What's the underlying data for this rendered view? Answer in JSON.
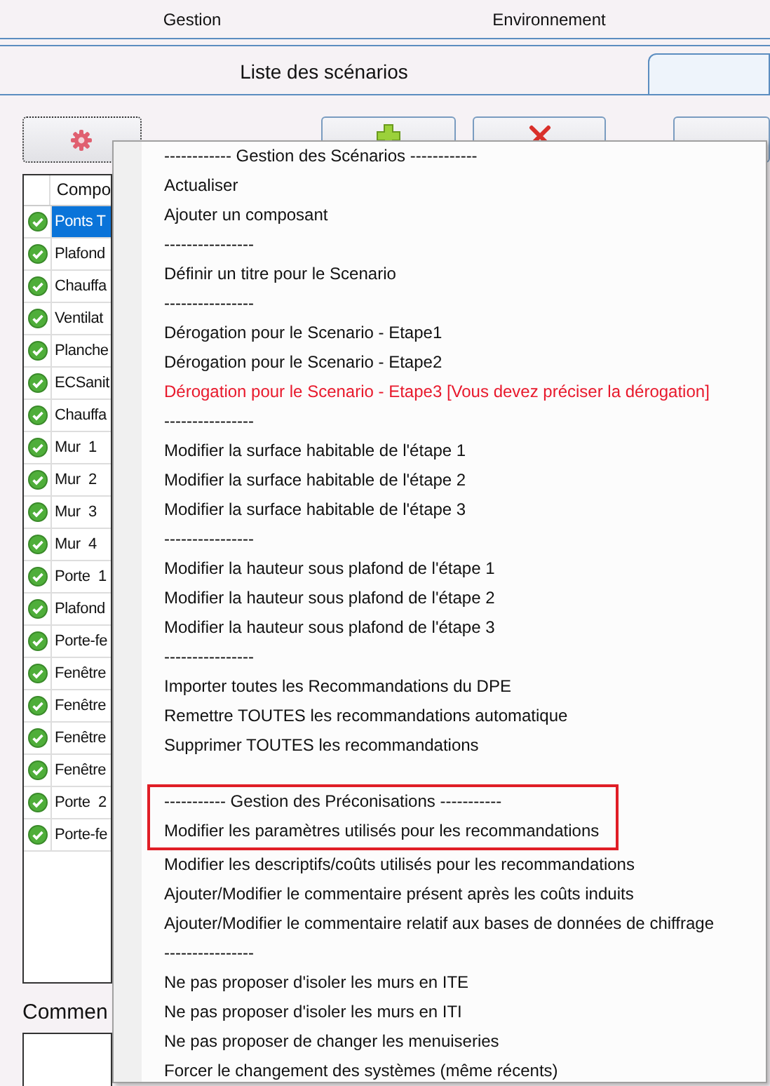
{
  "top_menu": [
    {
      "label": "Gestion"
    },
    {
      "label": "Environnement"
    }
  ],
  "tabs": [
    {
      "label": "Liste des scénarios",
      "selected": false
    },
    {
      "selected": true
    }
  ],
  "toolbar": [
    {
      "kind": "settings"
    },
    {
      "kind": "add"
    },
    {
      "kind": "delete"
    },
    {
      "kind": "blank"
    }
  ],
  "table": {
    "columns": [
      {
        "label": "Compo"
      }
    ],
    "rows": [
      {
        "label": "Ponts T",
        "selected": true
      },
      {
        "label": "Plafond",
        "selected": false
      },
      {
        "label": "Chauffa",
        "selected": false
      },
      {
        "label": "Ventilat",
        "selected": false
      },
      {
        "label": "Planche",
        "selected": false
      },
      {
        "label": "ECSanit",
        "selected": false
      },
      {
        "label": "Chauffa",
        "selected": false
      },
      {
        "label": "Mur  1",
        "selected": false
      },
      {
        "label": "Mur  2",
        "selected": false
      },
      {
        "label": "Mur  3",
        "selected": false
      },
      {
        "label": "Mur  4",
        "selected": false
      },
      {
        "label": "Porte  1",
        "selected": false
      },
      {
        "label": "Plafond",
        "selected": false
      },
      {
        "label": "Porte-fe",
        "selected": false
      },
      {
        "label": "Fenêtre",
        "selected": false
      },
      {
        "label": "Fenêtre",
        "selected": false
      },
      {
        "label": "Fenêtre",
        "selected": false
      },
      {
        "label": "Fenêtre",
        "selected": false
      },
      {
        "label": "Porte  2",
        "selected": false
      },
      {
        "label": "Porte-fe",
        "selected": false
      }
    ]
  },
  "comment_label": "Commen",
  "context_menu": {
    "sections": [
      {
        "highlighted": false,
        "items": [
          {
            "kind": "header",
            "label": "------------ Gestion des Scénarios ------------"
          },
          {
            "kind": "item",
            "label": "Actualiser"
          },
          {
            "kind": "item",
            "label": "Ajouter un composant"
          },
          {
            "kind": "separator",
            "label": "----------------"
          },
          {
            "kind": "item",
            "label": "Définir un titre pour le Scenario"
          },
          {
            "kind": "separator",
            "label": "----------------"
          },
          {
            "kind": "item",
            "label": "Dérogation pour le Scenario - Etape1"
          },
          {
            "kind": "item",
            "label": "Dérogation pour le Scenario - Etape2"
          },
          {
            "kind": "warning",
            "label": "Dérogation pour le Scenario - Etape3 [Vous devez préciser la dérogation]"
          },
          {
            "kind": "separator",
            "label": "----------------"
          },
          {
            "kind": "item",
            "label": "Modifier la surface habitable de l'étape 1"
          },
          {
            "kind": "item",
            "label": "Modifier la surface habitable de l'étape 2"
          },
          {
            "kind": "item",
            "label": "Modifier la surface habitable de l'étape 3"
          },
          {
            "kind": "separator",
            "label": "----------------"
          },
          {
            "kind": "item",
            "label": "Modifier la hauteur sous plafond de l'étape 1"
          },
          {
            "kind": "item",
            "label": "Modifier la hauteur sous plafond de l'étape 2"
          },
          {
            "kind": "item",
            "label": "Modifier la hauteur sous plafond de l'étape 3"
          },
          {
            "kind": "separator",
            "label": "----------------"
          },
          {
            "kind": "item",
            "label": "Importer toutes les Recommandations du DPE"
          },
          {
            "kind": "item",
            "label": "Remettre TOUTES les recommandations automatique"
          },
          {
            "kind": "item",
            "label": "Supprimer TOUTES les recommandations"
          }
        ]
      },
      {
        "highlighted": true,
        "items": [
          {
            "kind": "header",
            "label": "----------- Gestion des Préconisations -----------"
          },
          {
            "kind": "item",
            "label": "Modifier les paramètres utilisés pour les recommandations"
          }
        ]
      },
      {
        "highlighted": false,
        "items": [
          {
            "kind": "item",
            "label": "Modifier les descriptifs/coûts utilisés pour les recommandations"
          },
          {
            "kind": "item",
            "label": "Ajouter/Modifier le commentaire présent après les coûts induits"
          },
          {
            "kind": "item",
            "label": "Ajouter/Modifier le commentaire relatif aux bases de données de chiffrage"
          },
          {
            "kind": "separator",
            "label": "----------------"
          },
          {
            "kind": "item",
            "label": "Ne pas proposer d'isoler les murs en ITE"
          },
          {
            "kind": "item",
            "label": "Ne pas proposer d'isoler les murs en ITI"
          },
          {
            "kind": "item",
            "label": "Ne pas proposer de changer les menuiseries"
          },
          {
            "kind": "item",
            "label": "Forcer le changement des systèmes (même récents)"
          }
        ]
      }
    ]
  }
}
